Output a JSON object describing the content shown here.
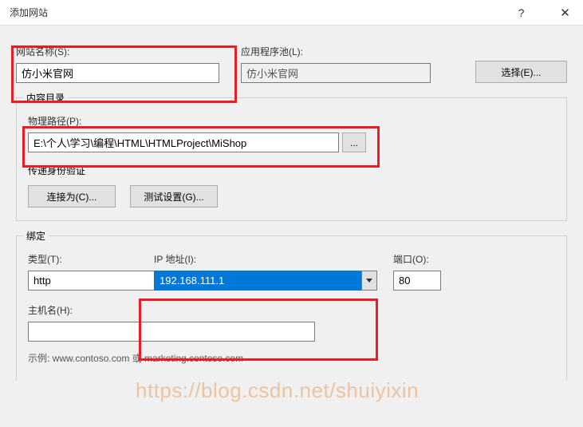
{
  "titlebar": {
    "title": "添加网站",
    "help": "?",
    "close": "✕"
  },
  "sitename": {
    "label": "网站名称(S):",
    "value": "仿小米官网"
  },
  "apppool": {
    "label": "应用程序池(L):",
    "value": "仿小米官网",
    "select_btn": "选择(E)..."
  },
  "content_dir": {
    "legend": "内容目录",
    "path_label": "物理路径(P):",
    "path_value": "E:\\个人\\学习\\编程\\HTML\\HTMLProject\\MiShop",
    "browse": "...",
    "auth_label": "传递身份验证",
    "connect_btn": "连接为(C)...",
    "test_btn": "测试设置(G)..."
  },
  "binding": {
    "legend": "绑定",
    "type_label": "类型(T):",
    "type_value": "http",
    "ip_label": "IP 地址(I):",
    "ip_value": "192.168.111.1",
    "port_label": "端口(O):",
    "port_value": "80",
    "host_label": "主机名(H):",
    "host_value": "",
    "example": "示例: www.contoso.com 或 marketing.contoso.com"
  },
  "watermark": "https://blog.csdn.net/shuiyixin"
}
